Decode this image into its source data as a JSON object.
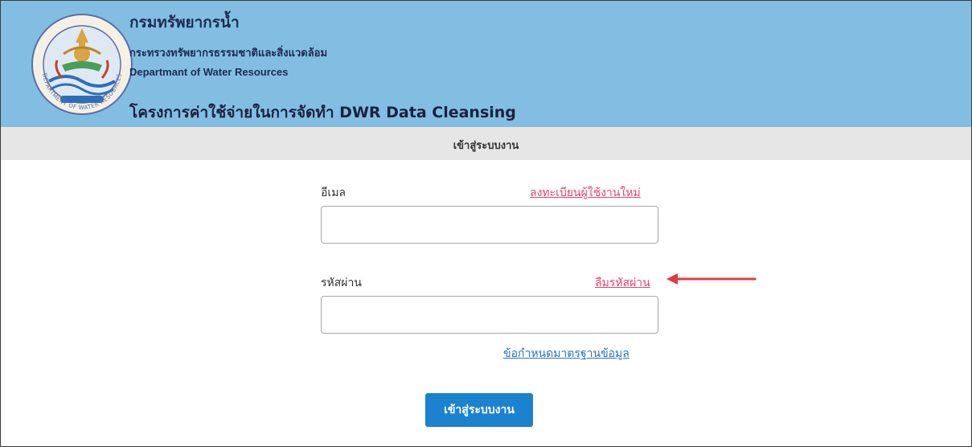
{
  "header": {
    "org_name_th": "กรมทรัพยากรน้ำ",
    "ministry_th": "กระทรวงทรัพยากรธรรมชาติและสิ่งแวดล้อม",
    "dept_name_en": "Departmant of Water Resources",
    "project_title": "โครงการค่าใช้จ่ายในการจัดทำ DWR Data Cleansing",
    "logo_seal_text": "DEPARTMENT OF WATER RESOURCES"
  },
  "subheader": {
    "title": "เข้าสู่ระบบงาน"
  },
  "form": {
    "email_label": "อีเมล",
    "register_link": "ลงทะเบียนผู้ใช้งานใหม่",
    "email_value": "",
    "password_label": "รหัสผ่าน",
    "forgot_link": "ลืมรหัสผ่าน",
    "password_value": "",
    "data_standard_link": "ข้อกำหนดมาตรฐานข้อมูล",
    "submit_label": "เข้าสู่ระบบงาน"
  },
  "colors": {
    "header_bg": "#82bee2",
    "subbar_bg": "#e6e6e6",
    "link_pink": "#e8436d",
    "link_blue": "#2a73c3",
    "button_bg": "#1b82cf",
    "annotation_arrow": "#e23b3b"
  }
}
